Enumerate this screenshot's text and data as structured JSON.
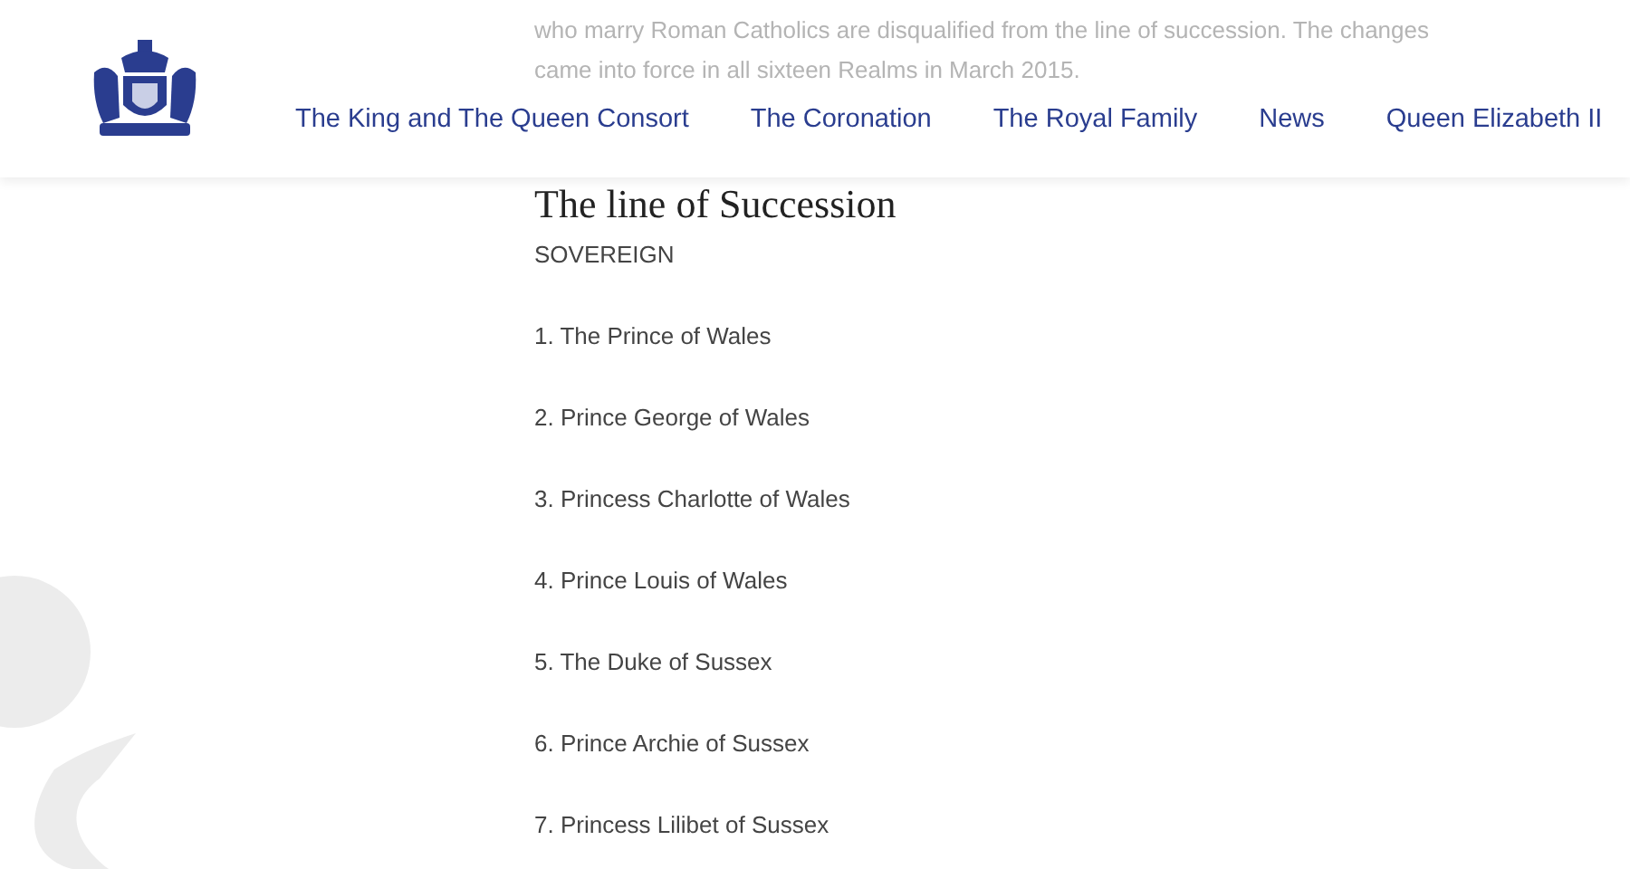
{
  "background_text": [
    "who marry Roman Catholics are disqualified from the line of succession. The changes",
    "came into force in all sixteen Realms in March 2015."
  ],
  "nav": {
    "items": [
      {
        "label": "The King and The Queen Consort"
      },
      {
        "label": "The Coronation"
      },
      {
        "label": "The Royal Family"
      },
      {
        "label": "News"
      },
      {
        "label": "Queen Elizabeth II"
      }
    ]
  },
  "heading": "The line of Succession",
  "sovereign": "SOVEREIGN",
  "succession": [
    "1. The Prince of Wales",
    "2. Prince George of Wales",
    "3. Princess Charlotte of Wales",
    "4. Prince Louis of Wales",
    "5. The Duke of Sussex",
    "6. Prince Archie of Sussex",
    "7. Princess Lilibet of Sussex"
  ]
}
